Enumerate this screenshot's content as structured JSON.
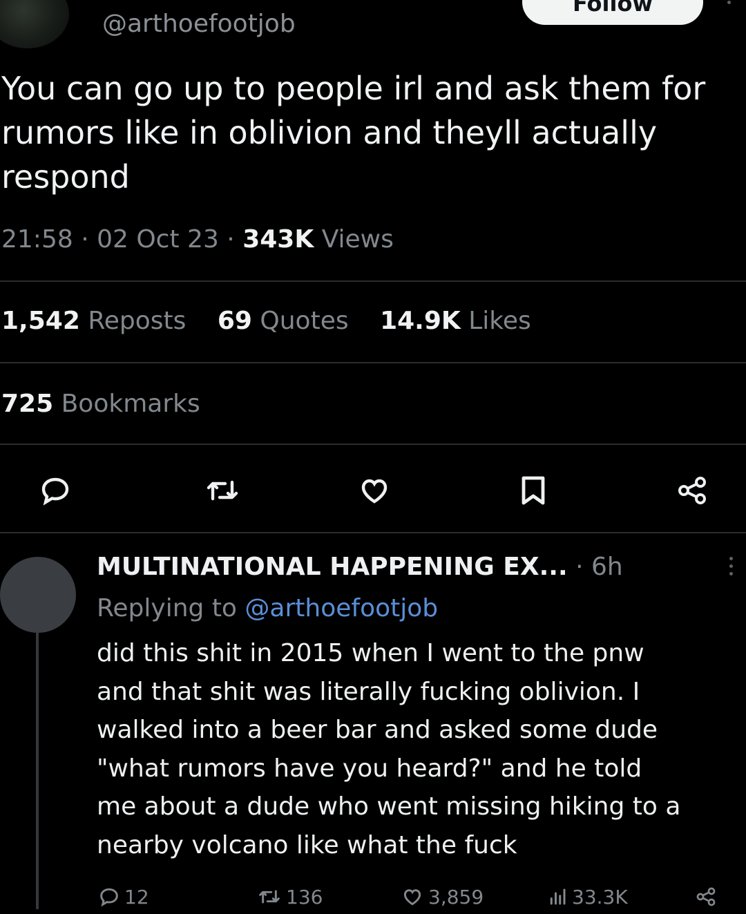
{
  "tweet": {
    "handle": "@arthoefootjob",
    "follow_label": "Follow",
    "text": "You can go up to people irl and ask them for\nrumors like in oblivion and theyll actually\nrespond",
    "time": "21:58",
    "date": "02 Oct 23",
    "views_count": "343K",
    "views_label": "Views",
    "reposts_count": "1,542",
    "reposts_label": "Reposts",
    "quotes_count": "69",
    "quotes_label": "Quotes",
    "likes_count": "14.9K",
    "likes_label": "Likes",
    "bookmarks_count": "725",
    "bookmarks_label": "Bookmarks",
    "actions": [
      "reply-icon",
      "repost-icon",
      "like-icon",
      "bookmark-icon",
      "share-icon"
    ]
  },
  "reply": {
    "display_name": "MULTINATIONAL HAPPENING EX...",
    "time": "6h",
    "replying_prefix": "Replying to",
    "replying_handle": "@arthoefootjob",
    "text": "did this shit in 2015 when I went to the pnw\nand that shit was literally fucking oblivion. I\nwalked into a beer bar and asked some dude\n\"what rumors have you heard?\" and he told\nme about a dude who went missing hiking to a\nnearby volcano like what the fuck",
    "replies": "12",
    "reposts": "136",
    "likes": "3,859",
    "views": "33.3K"
  },
  "colors": {
    "background": "#000000",
    "text_primary": "#e7e9ea",
    "text_secondary": "#82888d",
    "link": "#5a8fd8",
    "divider": "#2a2e31"
  }
}
